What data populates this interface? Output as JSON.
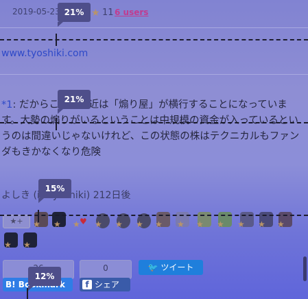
{
  "entry": {
    "date": "2019-05-23",
    "star_glyph": "★",
    "star_count": "11",
    "users_label": "6 users",
    "site_link": "www.tyoshiki.com"
  },
  "comment": {
    "number": "*1",
    "text": ": だからこそ、最近は「煽り屋」が横行することになっています。大勢の煽りがいるということは中規模の資金が入っているというのは間違いじゃないけれど、この状態の株はテクニカルもファンダもきかなくなり危険",
    "author": "よしき (id:tyoshiki) 212日後"
  },
  "stars": {
    "add_label": "★+"
  },
  "share": {
    "hatena_count": "26",
    "hatena_label": "B! Bookmark",
    "facebook_count": "0",
    "facebook_icon_letter": "f",
    "facebook_label": "シェア",
    "tweet_label": "ツイート"
  },
  "overlay": {
    "badge1": "21%",
    "badge2": "21%",
    "badge3": "15%",
    "badge4": "12%"
  },
  "colors": {
    "link": "#2e49c8",
    "users": "#c13b8f",
    "star": "#b8946a",
    "badge": "#4e4e8a"
  }
}
